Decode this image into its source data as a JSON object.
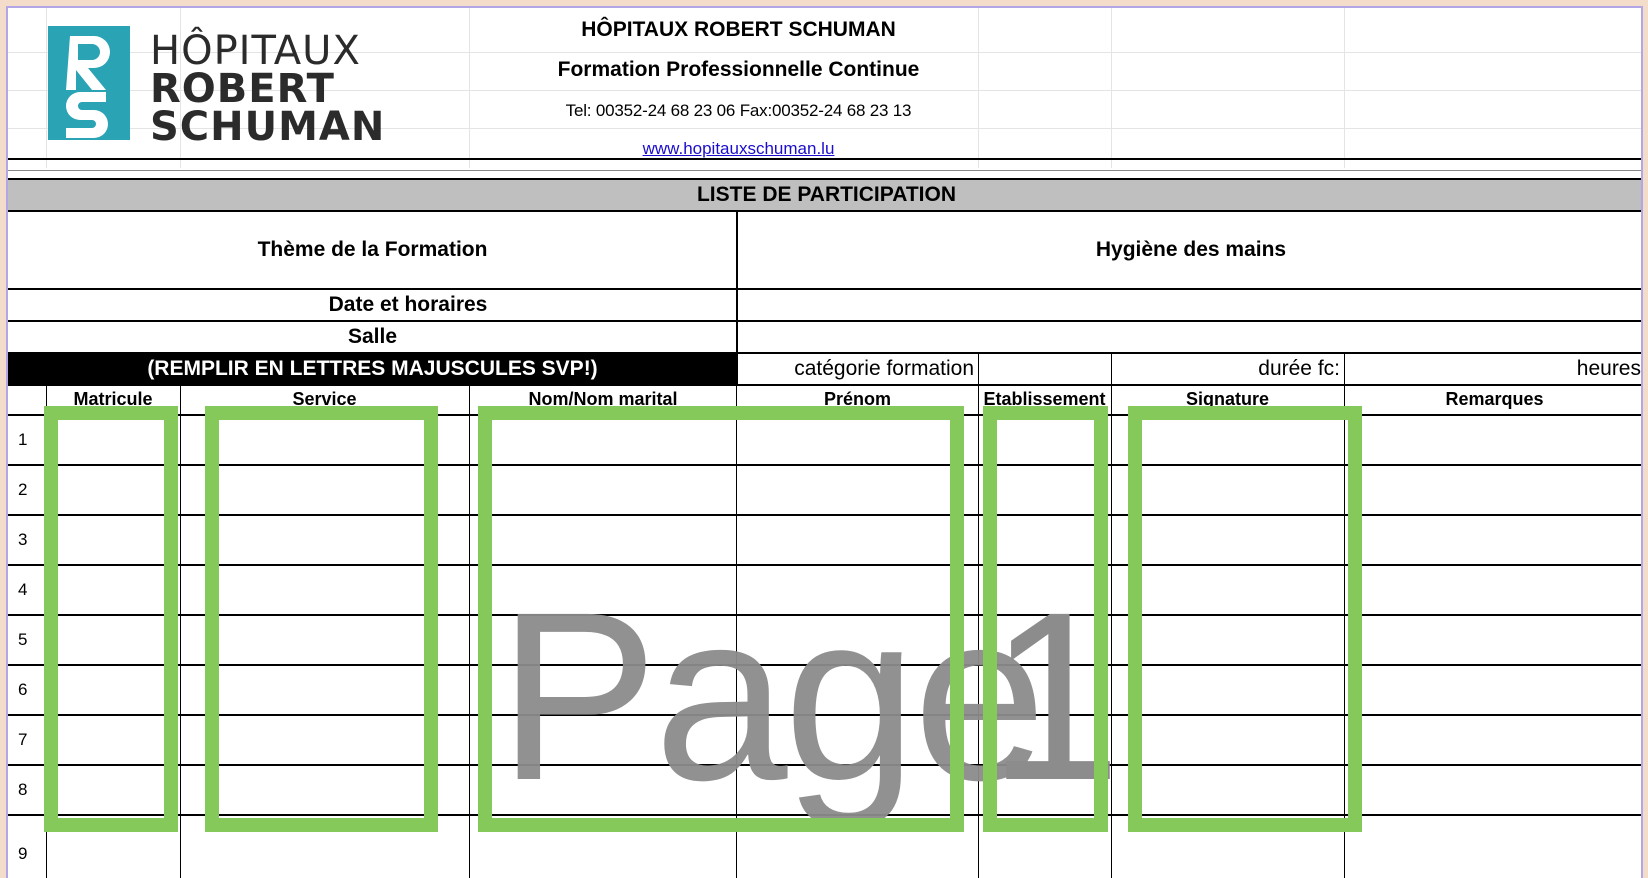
{
  "header": {
    "logo_lines": [
      "HÔPITAUX",
      "ROBERT",
      "SCHUMAN"
    ],
    "logo_monogram": "RS",
    "title": "HÔPITAUX ROBERT SCHUMAN",
    "subtitle": "Formation Professionnelle Continue",
    "contact": "Tel: 00352-24 68 23 06   Fax:00352-24 68 23 13",
    "website": "www.hopitauxschuman.lu"
  },
  "form": {
    "banner": "LISTE DE PARTICIPATION",
    "theme_label": "Thème de la Formation",
    "theme_value": "Hygiène des mains",
    "date_label": "Date et horaires",
    "room_label": "Salle",
    "fill_notice": "(REMPLIR EN LETTRES MAJUSCULES SVP!)",
    "category_label": "catégorie formation",
    "duration_label": "durée fc:",
    "hours_label": "heures"
  },
  "table": {
    "columns": [
      "Matricule",
      "Service",
      "Nom/Nom marital",
      "Prénom",
      "Etablissement",
      "Signature",
      "Remarques"
    ],
    "row_numbers": [
      "1",
      "2",
      "3",
      "4",
      "5",
      "6",
      "7",
      "8",
      "9"
    ]
  },
  "watermark": {
    "text": "Page",
    "number": "1"
  },
  "colors": {
    "highlight": "#84c95a",
    "banner": "#bfbfbf",
    "logo": "#2aa3b4"
  }
}
